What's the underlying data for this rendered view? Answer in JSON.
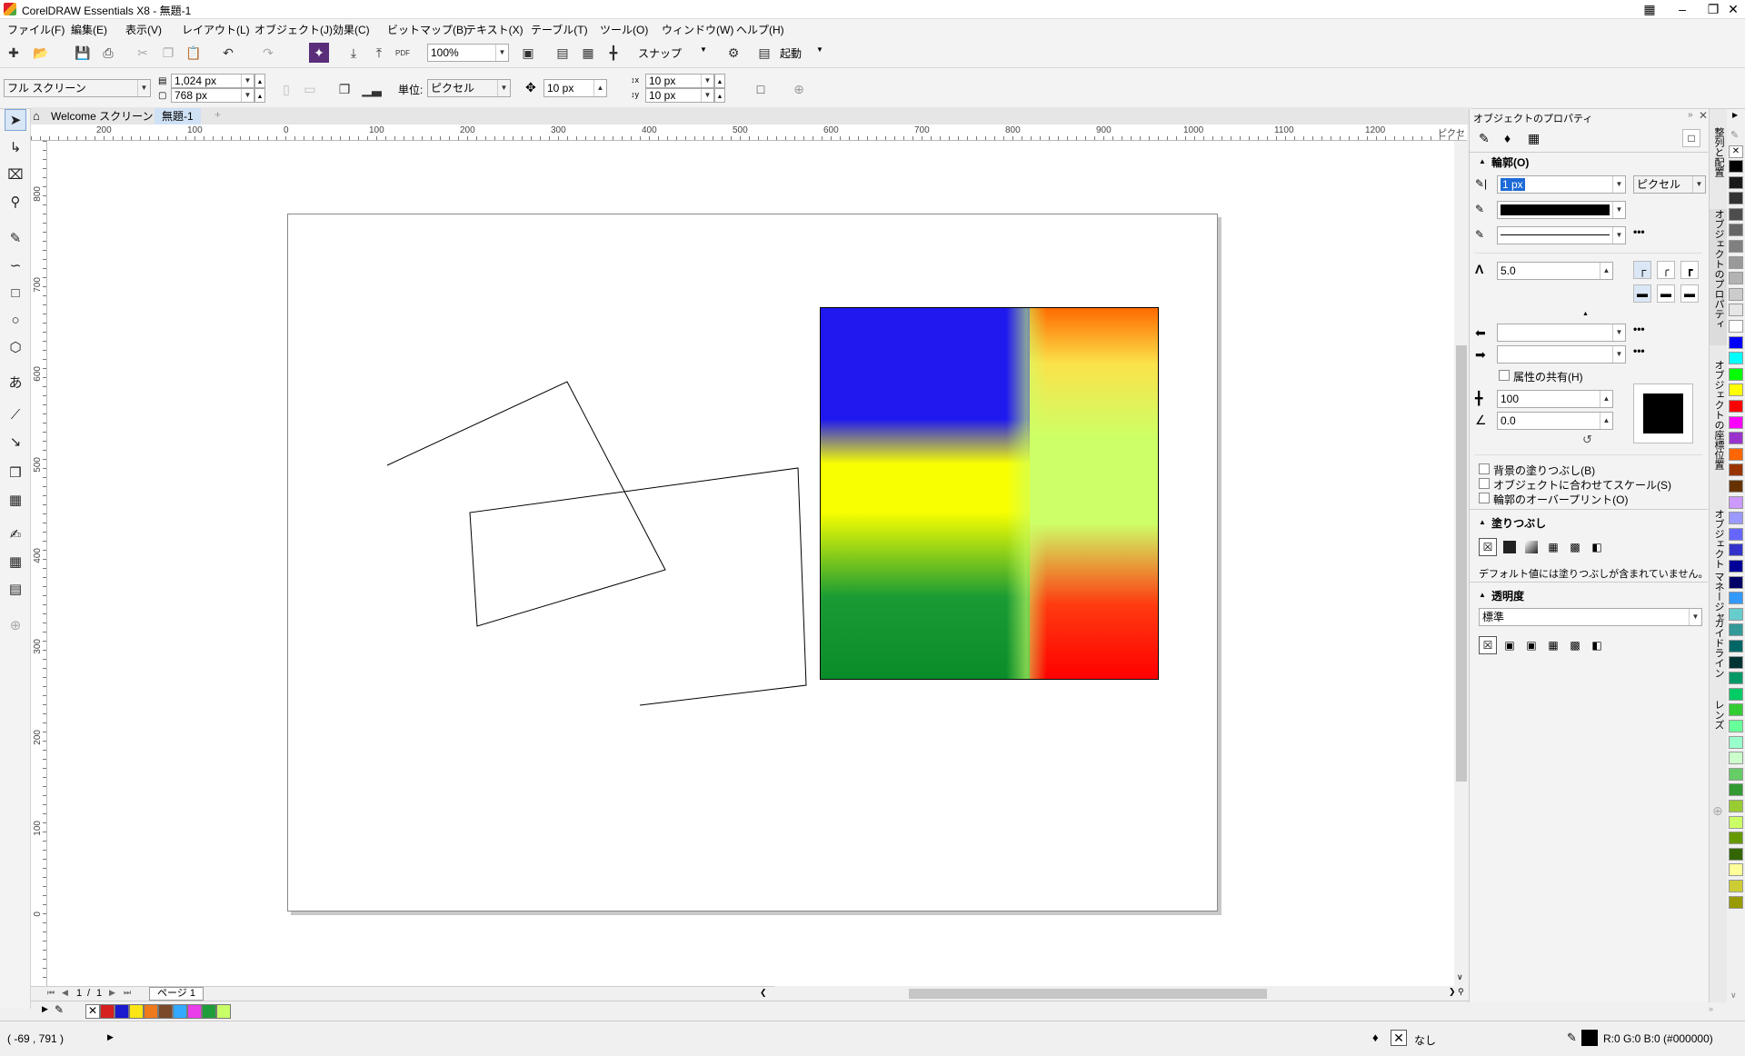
{
  "window": {
    "title": "CorelDRAW Essentials X8 - 無題-1"
  },
  "menu": [
    "ファイル(F)",
    "編集(E)",
    "表示(V)",
    "レイアウト(L)",
    "オブジェクト(J)",
    "効果(C)",
    "ビットマップ(B)",
    "テキスト(X)",
    "テーブル(T)",
    "ツール(O)",
    "ウィンドウ(W)",
    "ヘルプ(H)"
  ],
  "standard_toolbar": {
    "zoom": "100%",
    "snap": "スナップ",
    "launch": "起動",
    "pdf": "PDF"
  },
  "property_bar": {
    "page_preset": "フル スクリーン",
    "width": "1,024 px",
    "height": "768 px",
    "unit_label": "単位:",
    "unit": "ピクセル",
    "nudge": "10 px",
    "dup_x": "10 px",
    "dup_y": "10 px"
  },
  "tabs": [
    "Welcome スクリーン",
    "無題-1"
  ],
  "ruler": {
    "h_labels": [
      "200",
      "100",
      "0",
      "100",
      "200",
      "300",
      "400",
      "500",
      "600",
      "700",
      "800",
      "900",
      "1000",
      "1100",
      "1200",
      "ピクセル"
    ],
    "v_labels": [
      "800",
      "700",
      "600",
      "500",
      "400",
      "300",
      "200",
      "100",
      "0"
    ]
  },
  "page_nav": {
    "current": "1",
    "sep": "/",
    "total": "1",
    "page_tab": "ページ 1"
  },
  "docker": {
    "title": "オブジェクトのプロパティ",
    "outline": {
      "header": "輪郭(O)",
      "width": "1 px",
      "unit": "ピクセル",
      "miter": "5.0",
      "share_attr": "属性の共有(H)",
      "stretch": "100",
      "angle": "0.0"
    },
    "checkboxes": [
      "背景の塗りつぶし(B)",
      "オブジェクトに合わせてスケール(S)",
      "輪郭のオーバープリント(O)"
    ],
    "fill": {
      "header": "塗りつぶし",
      "note": "デフォルト値には塗りつぶしが含まれていません。"
    },
    "transparency": {
      "header": "透明度",
      "mode": "標準"
    }
  },
  "side_tabs": [
    "整列と配置",
    "オブジェクトのプロパティ",
    "オブジェクトの座標位置",
    "オブジェクト マネージャ",
    "ガイドライン",
    "レンズ"
  ],
  "status": {
    "coords": "( -69 , 791 )",
    "fill_label": "なし",
    "outline": "R:0 G:0 B:0 (#000000)"
  },
  "doc_palette": [
    "#d61f1f",
    "#1a1acf",
    "#fbe514",
    "#ee7a1c",
    "#7a4a2a",
    "#33aaff",
    "#e93ee9",
    "#1f9d3a",
    "#c8ff66"
  ],
  "color_palette": [
    "#000000",
    "#1a1a1a",
    "#333333",
    "#4d4d4d",
    "#666666",
    "#808080",
    "#999999",
    "#b3b3b3",
    "#cccccc",
    "#e6e6e6",
    "#ffffff",
    "#0000ff",
    "#00ffff",
    "#00ff00",
    "#ffff00",
    "#ff0000",
    "#ff00ff",
    "#9933cc",
    "#ff6600",
    "#993300",
    "#663300",
    "#cc99ff",
    "#9999ff",
    "#6666ff",
    "#3333cc",
    "#000099",
    "#000066",
    "#3399ff",
    "#66cccc",
    "#339999",
    "#006666",
    "#003333",
    "#009966",
    "#00cc66",
    "#33cc33",
    "#66ff99",
    "#99ffcc",
    "#ccffcc",
    "#66cc66",
    "#339933",
    "#99cc33",
    "#ccff66",
    "#669900",
    "#336600",
    "#ffff99",
    "#cccc33",
    "#999900"
  ]
}
